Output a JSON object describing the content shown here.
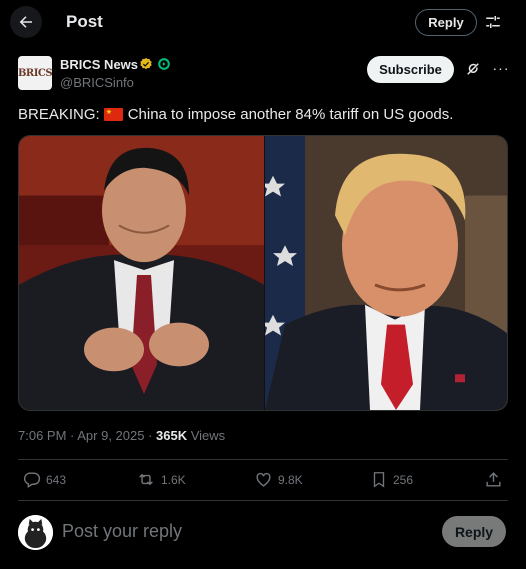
{
  "header": {
    "title": "Post",
    "reply_label": "Reply",
    "back_icon": "arrow-left-icon",
    "settings_icon": "sliders-icon"
  },
  "author": {
    "name": "BRICS News",
    "handle": "@BRICSinfo",
    "avatar_text": "BRICS",
    "subscribe_label": "Subscribe",
    "more_label": "···"
  },
  "tweet": {
    "prefix": "BREAKING:",
    "body": "China to impose another 84% tariff on US goods."
  },
  "meta": {
    "time": "7:06 PM · Apr 9, 2025 · ",
    "views_count": "365K",
    "views_label": " Views"
  },
  "actions": {
    "replies": "643",
    "reposts": "1.6K",
    "likes": "9.8K",
    "bookmarks": "256"
  },
  "compose": {
    "placeholder": "Post your reply",
    "reply_label": "Reply"
  },
  "colors": {
    "background": "#000000",
    "text": "#e7e9ea",
    "muted": "#71767b",
    "verified_gold": "#e2b719",
    "affiliate_green": "#00ba7c"
  }
}
